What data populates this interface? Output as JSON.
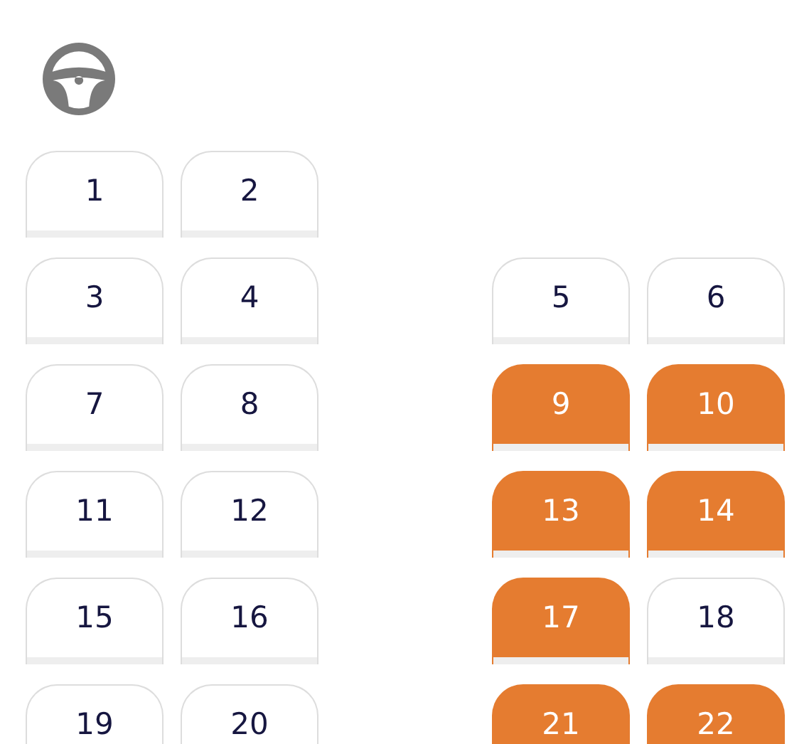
{
  "rows": [
    {
      "left": [
        {
          "label": "1",
          "booked": false
        },
        {
          "label": "2",
          "booked": false
        }
      ],
      "right": []
    },
    {
      "left": [
        {
          "label": "3",
          "booked": false
        },
        {
          "label": "4",
          "booked": false
        }
      ],
      "right": [
        {
          "label": "5",
          "booked": false
        },
        {
          "label": "6",
          "booked": false
        }
      ]
    },
    {
      "left": [
        {
          "label": "7",
          "booked": false
        },
        {
          "label": "8",
          "booked": false
        }
      ],
      "right": [
        {
          "label": "9",
          "booked": true
        },
        {
          "label": "10",
          "booked": true
        }
      ]
    },
    {
      "left": [
        {
          "label": "11",
          "booked": false
        },
        {
          "label": "12",
          "booked": false
        }
      ],
      "right": [
        {
          "label": "13",
          "booked": true
        },
        {
          "label": "14",
          "booked": true
        }
      ]
    },
    {
      "left": [
        {
          "label": "15",
          "booked": false
        },
        {
          "label": "16",
          "booked": false
        }
      ],
      "right": [
        {
          "label": "17",
          "booked": true
        },
        {
          "label": "18",
          "booked": false
        }
      ]
    },
    {
      "left": [
        {
          "label": "19",
          "booked": false
        },
        {
          "label": "20",
          "booked": false
        }
      ],
      "right": [
        {
          "label": "21",
          "booked": true
        },
        {
          "label": "22",
          "booked": true
        }
      ]
    }
  ]
}
